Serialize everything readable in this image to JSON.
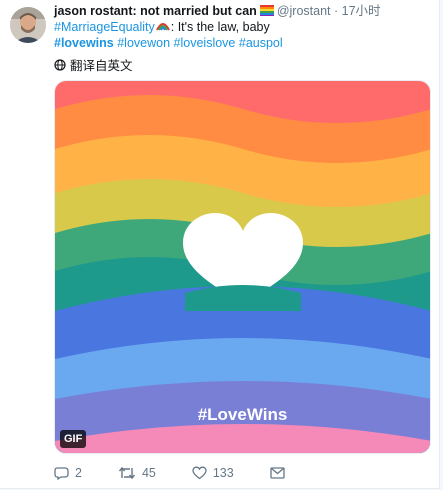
{
  "user": {
    "display_name": "jason rostant: not married but can",
    "handle": "@jrostant",
    "separator": "·",
    "time": "17小时"
  },
  "tweet": {
    "hashtag_1": "#MarriageEquality",
    "text_rest": ": It's the law, baby",
    "hashtag_2": "#lovewins",
    "hashtag_3": "#lovewon",
    "hashtag_4": "#loveislove",
    "hashtag_5": "#auspol"
  },
  "translate_label": "翻译自英文",
  "media": {
    "overlay_text": "#LoveWins",
    "badge": "GIF",
    "colors": [
      "#ff6b6b",
      "#ff8c42",
      "#ffb347",
      "#d9c94a",
      "#3fa87a",
      "#1e9a8d",
      "#4a76e0",
      "#6aa8f0",
      "#7a7fd6",
      "#f58ab8"
    ]
  },
  "actions": {
    "reply_count": "2",
    "retweet_count": "45",
    "like_count": "133"
  },
  "icons": {
    "avatar": "avatar-image",
    "globe": "globe-icon",
    "reply": "reply-icon",
    "retweet": "retweet-icon",
    "like": "heart-icon",
    "message": "mail-icon"
  }
}
